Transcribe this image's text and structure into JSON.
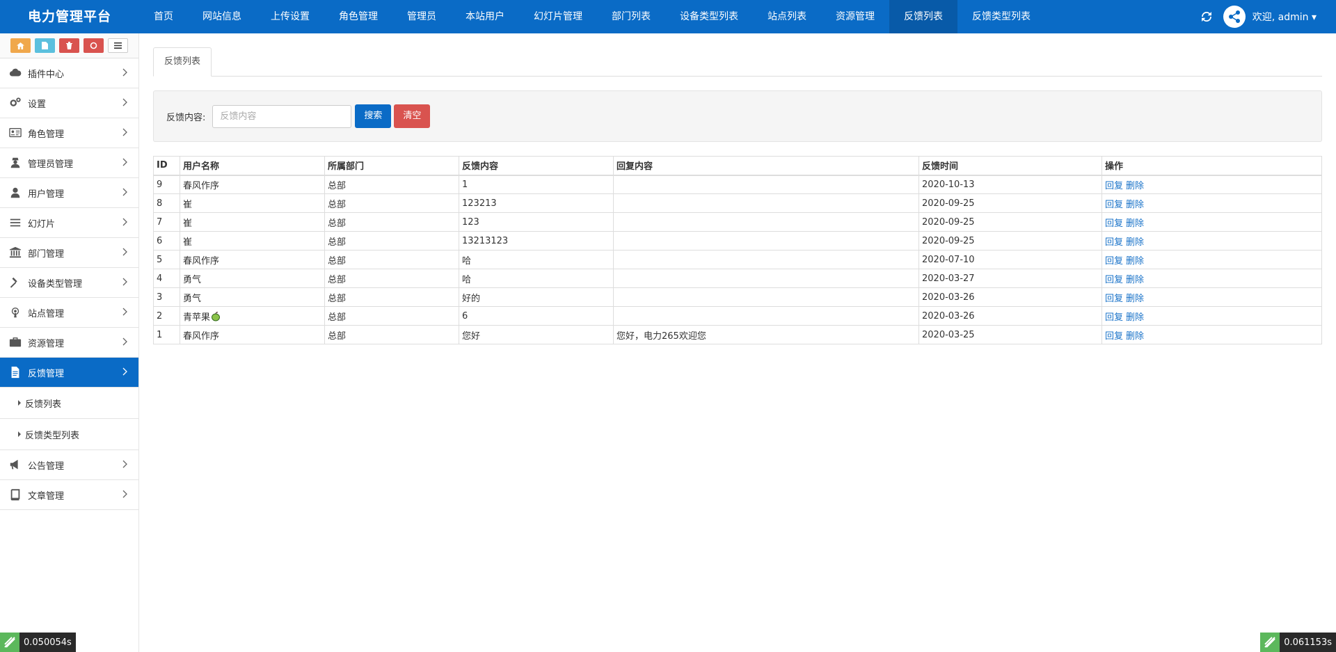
{
  "brand": "电力管理平台",
  "top_nav": [
    {
      "label": "首页"
    },
    {
      "label": "网站信息"
    },
    {
      "label": "上传设置"
    },
    {
      "label": "角色管理"
    },
    {
      "label": "管理员"
    },
    {
      "label": "本站用户"
    },
    {
      "label": "幻灯片管理"
    },
    {
      "label": "部门列表"
    },
    {
      "label": "设备类型列表"
    },
    {
      "label": "站点列表"
    },
    {
      "label": "资源管理"
    },
    {
      "label": "反馈列表",
      "active": true
    },
    {
      "label": "反馈类型列表"
    }
  ],
  "user": {
    "welcome": "欢迎, admin ▾"
  },
  "sidebar": {
    "menu": [
      {
        "label": "插件中心",
        "icon": "cloud-icon"
      },
      {
        "label": "设置",
        "icon": "gears-icon"
      },
      {
        "label": "角色管理",
        "icon": "id-card-icon"
      },
      {
        "label": "管理员管理",
        "icon": "user-secret-icon"
      },
      {
        "label": "用户管理",
        "icon": "user-icon"
      },
      {
        "label": "幻灯片",
        "icon": "bars-icon"
      },
      {
        "label": "部门管理",
        "icon": "bank-icon"
      },
      {
        "label": "设备类型管理",
        "icon": "gavel-icon"
      },
      {
        "label": "站点管理",
        "icon": "podcast-icon"
      },
      {
        "label": "资源管理",
        "icon": "briefcase-icon"
      },
      {
        "label": "反馈管理",
        "icon": "file-icon",
        "active": true
      },
      {
        "label": "公告管理",
        "icon": "bullhorn-icon"
      },
      {
        "label": "文章管理",
        "icon": "book-icon"
      }
    ],
    "sub_items": [
      "反馈列表",
      "反馈类型列表"
    ]
  },
  "tab": "反馈列表",
  "search": {
    "label": "反馈内容:",
    "placeholder": "反馈内容",
    "search_btn": "搜索",
    "clear_btn": "清空"
  },
  "table": {
    "headers": [
      "ID",
      "用户名称",
      "所属部门",
      "反馈内容",
      "回复内容",
      "反馈时间",
      "操作"
    ],
    "rows": [
      {
        "id": "9",
        "user": "春风作序",
        "dept": "总部",
        "content": "1",
        "reply": "",
        "time": "2020-10-13"
      },
      {
        "id": "8",
        "user": "崔",
        "dept": "总部",
        "content": "123213",
        "reply": "",
        "time": "2020-09-25"
      },
      {
        "id": "7",
        "user": "崔",
        "dept": "总部",
        "content": "123",
        "reply": "",
        "time": "2020-09-25"
      },
      {
        "id": "6",
        "user": "崔",
        "dept": "总部",
        "content": "13213123",
        "reply": "",
        "time": "2020-09-25"
      },
      {
        "id": "5",
        "user": "春风作序",
        "dept": "总部",
        "content": "哈",
        "reply": "",
        "time": "2020-07-10"
      },
      {
        "id": "4",
        "user": "勇气",
        "dept": "总部",
        "content": "哈",
        "reply": "",
        "time": "2020-03-27"
      },
      {
        "id": "3",
        "user": "勇气",
        "dept": "总部",
        "content": "好的",
        "reply": "",
        "time": "2020-03-26"
      },
      {
        "id": "2",
        "user": "青苹果",
        "dept": "总部",
        "content": "6",
        "reply": "",
        "time": "2020-03-26",
        "apple": true
      },
      {
        "id": "1",
        "user": "春风作序",
        "dept": "总部",
        "content": "您好",
        "reply": "您好，电力265欢迎您",
        "time": "2020-03-25"
      }
    ],
    "ops": {
      "reply": "回复",
      "delete": "删除"
    }
  },
  "timers": {
    "left": "0.050054s",
    "right": "0.061153s"
  },
  "colors": {
    "primary": "#0a6bc6",
    "danger": "#d9534f",
    "link": "#1a73c9"
  }
}
